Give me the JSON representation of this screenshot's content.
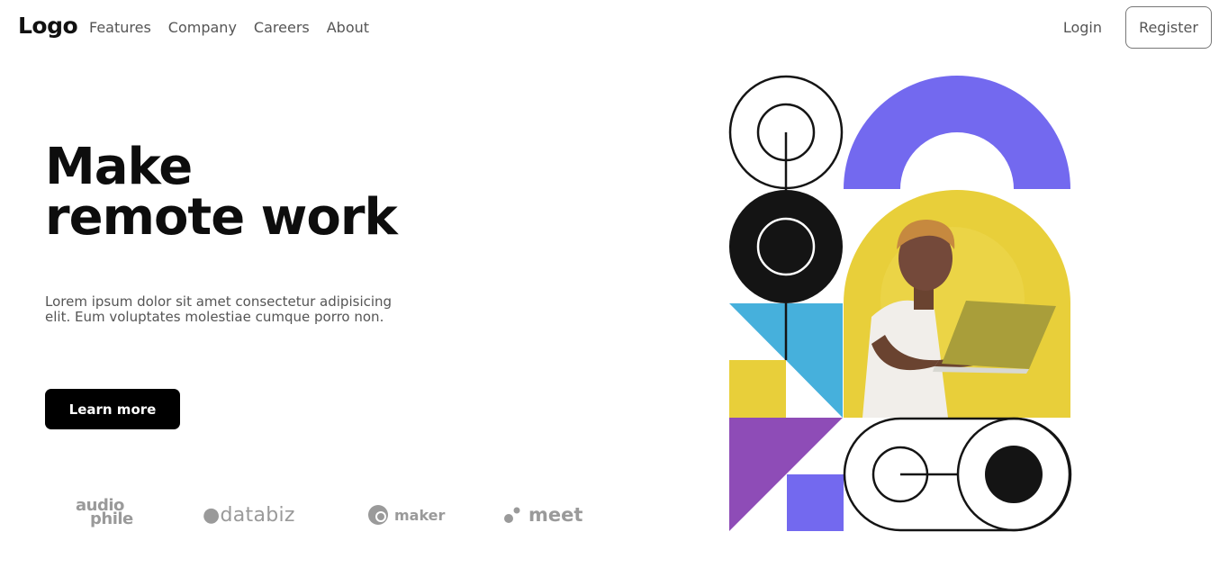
{
  "nav": {
    "logo": "Logo",
    "links": [
      "Features",
      "Company",
      "Careers",
      "About"
    ],
    "login": "Login",
    "register": "Register"
  },
  "hero": {
    "title_line1": "Make",
    "title_line2": "remote work",
    "description": "Lorem ipsum dolor sit amet consectetur adipisicing elit. Eum voluptates molestiae cumque porro non.",
    "cta": "Learn more"
  },
  "brands": {
    "audiophile_line1": "audio",
    "audiophile_line2": "phile",
    "databiz": "databiz",
    "maker": "maker",
    "meet": "meet"
  },
  "colors": {
    "purple": "#7369EF",
    "yellow": "#E8CF3A",
    "blue": "#46B0DC",
    "violet": "#8E4CB7",
    "dark": "#141414"
  },
  "illustration": {
    "photo_subject": "person-with-laptop-icon"
  }
}
